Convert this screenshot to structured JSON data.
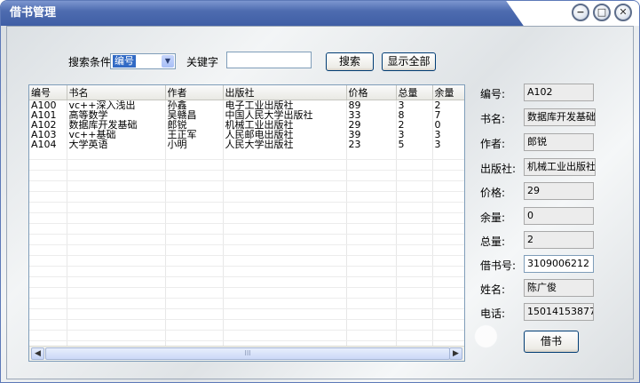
{
  "window": {
    "title": "借书管理"
  },
  "titlebar_buttons": {
    "minimize": "−",
    "maximize": "□",
    "close": "✕"
  },
  "search": {
    "condition_label": "搜索条件",
    "condition_value": "编号",
    "keyword_label": "关键字",
    "keyword_value": "",
    "search_button": "搜索",
    "show_all_button": "显示全部"
  },
  "table": {
    "columns": [
      "编号",
      "书名",
      "作者",
      "出版社",
      "价格",
      "总量",
      "余量"
    ],
    "rows": [
      [
        "A100",
        "vc++深入浅出",
        "孙鑫",
        "电子工业出版社",
        "89",
        "3",
        "2"
      ],
      [
        "A101",
        "高等数学",
        "吴赣昌",
        "中国人民大学出版社",
        "33",
        "8",
        "7"
      ],
      [
        "A102",
        "数据库开发基础",
        "郎锐",
        "机械工业出版社",
        "29",
        "2",
        "0"
      ],
      [
        "A103",
        "vc++基础",
        "王正军",
        "人民邮电出版社",
        "39",
        "3",
        "3"
      ],
      [
        "A104",
        "大学英语",
        "小明",
        "人民大学出版社",
        "23",
        "5",
        "3"
      ]
    ],
    "scroll_left": "◀",
    "scroll_right": "▶",
    "scroll_grip": "III"
  },
  "detail": {
    "id_label": "编号:",
    "id_value": "A102",
    "name_label": "书名:",
    "name_value": "数据库开发基础",
    "author_label": "作者:",
    "author_value": "郎锐",
    "publisher_label": "出版社:",
    "publisher_value": "机械工业出版社",
    "price_label": "价格:",
    "price_value": "29",
    "remain_label": "余量:",
    "remain_value": "0",
    "total_label": "总量:",
    "total_value": "2",
    "card_label": "借书号:",
    "card_value": "3109006212",
    "reader_label": "姓名:",
    "reader_value": "陈广俊",
    "phone_label": "电话:",
    "phone_value": "15014153877",
    "borrow_button": "借书"
  }
}
